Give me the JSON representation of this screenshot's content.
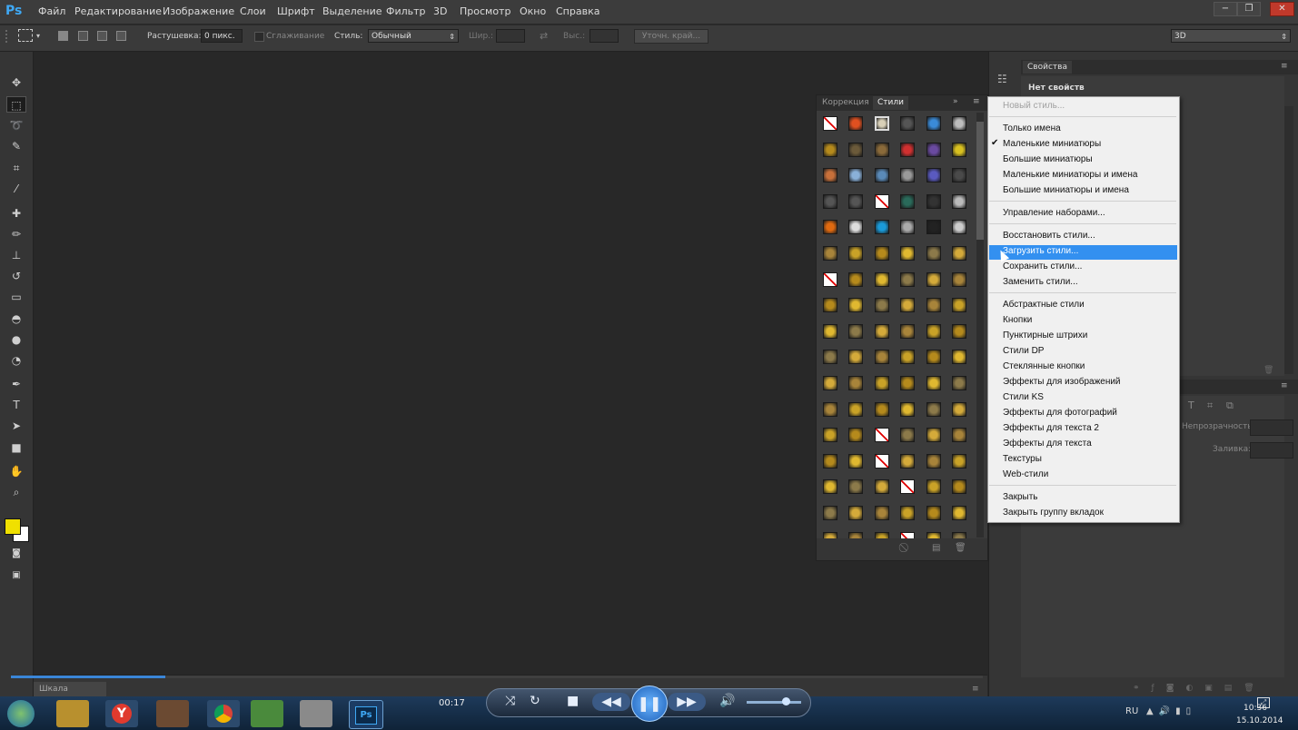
{
  "app": {
    "logo": "Ps"
  },
  "menu": [
    "Файл",
    "Редактирование",
    "Изображение",
    "Слои",
    "Шрифт",
    "Выделение",
    "Фильтр",
    "3D",
    "Просмотр",
    "Окно",
    "Справка"
  ],
  "options": {
    "feather_label": "Растушевка:",
    "feather_value": "0 пикс.",
    "antialias_label": "Сглаживание",
    "style_label": "Стиль:",
    "style_value": "Обычный",
    "width_label": "Шир.:",
    "height_label": "Выс.:",
    "refine_button": "Уточн. край...",
    "workspace_value": "3D"
  },
  "panels": {
    "tab_corrections": "Коррекция",
    "tab_styles": "Стили",
    "properties_title": "Свойства",
    "properties_empty": "Нет свойств",
    "opacity_label": "Непрозрачность:",
    "fill_label": "Заливка:"
  },
  "flyout": {
    "new_style": "Новый стиль...",
    "view_items": [
      "Только имена",
      "Маленькие миниатюры",
      "Большие миниатюры",
      "Маленькие миниатюры и имена",
      "Большие миниатюры и имена"
    ],
    "checked_index": 1,
    "manage": "Управление наборами...",
    "file_items": [
      "Восстановить стили...",
      "Загрузить стили...",
      "Сохранить стили...",
      "Заменить стили..."
    ],
    "highlighted": "Загрузить стили...",
    "libraries": [
      "Абстрактные стили",
      "Кнопки",
      "Пунктирные штрихи",
      "Стили DP",
      "Стеклянные кнопки",
      "Эффекты для изображений",
      "Стили KS",
      "Эффекты для фотографий",
      "Эффекты для текста 2",
      "Эффекты для текста",
      "Текстуры",
      "Web-стили"
    ],
    "close": "Закрыть",
    "close_group": "Закрыть группу вкладок"
  },
  "timeline": {
    "tab_label": "Шкала времени"
  },
  "player": {
    "time": "00:17"
  },
  "taskbar": {
    "lang": "RU",
    "clock_time": "10:36",
    "clock_date": "15.10.2014"
  },
  "colors": {
    "foreground": "#f0e000",
    "background": "#ffffff",
    "highlight": "#3390f0",
    "accent": "#3a86d8"
  }
}
